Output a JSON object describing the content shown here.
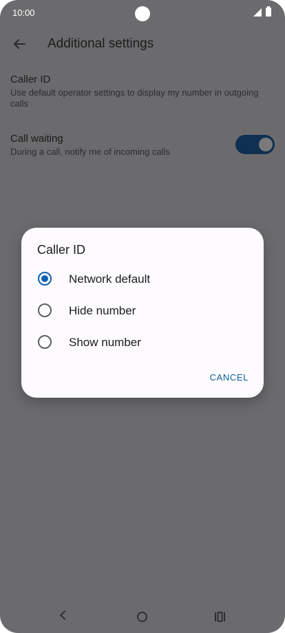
{
  "status_bar": {
    "time": "10:00",
    "icons": [
      "signal-icon",
      "battery-icon"
    ]
  },
  "header": {
    "title": "Additional settings",
    "back_icon": "arrow-left-icon"
  },
  "settings": [
    {
      "title": "Caller ID",
      "subtitle": "Use default operator settings to display my number in outgoing calls"
    },
    {
      "title": "Call waiting",
      "subtitle": "During a call, notify me of incoming calls",
      "toggle_on": true
    }
  ],
  "dialog": {
    "title": "Caller ID",
    "options": [
      {
        "label": "Network default",
        "selected": true
      },
      {
        "label": "Hide number",
        "selected": false
      },
      {
        "label": "Show number",
        "selected": false
      }
    ],
    "cancel_label": "CANCEL"
  },
  "nav_bar": {
    "icons": [
      "back-icon",
      "home-icon",
      "recents-icon"
    ]
  },
  "colors": {
    "overlay_background": "#6b6b6d",
    "toggle_track": "#0f3050",
    "radio_accent": "#0b5eb3",
    "dialog_background": "#fdfbff",
    "cancel_text": "#0b5e96"
  }
}
